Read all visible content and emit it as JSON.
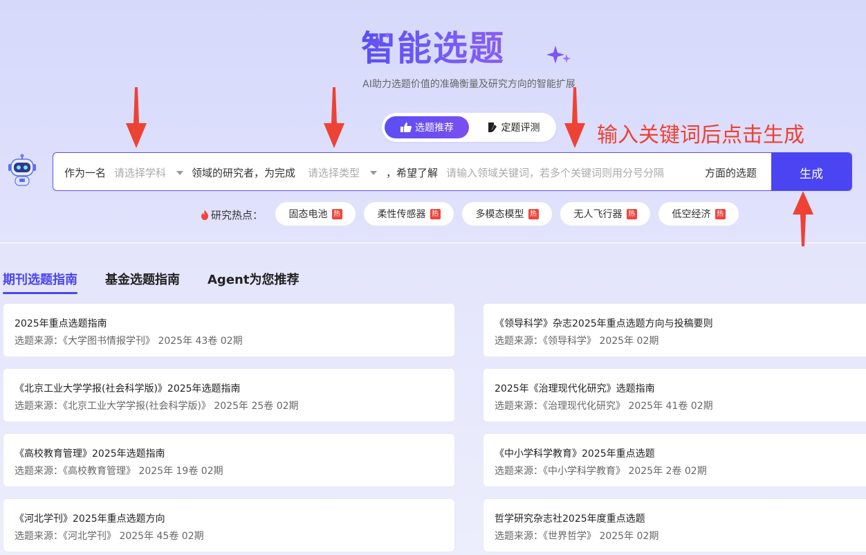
{
  "header": {
    "title": "智能选题",
    "subtitle": "AI助力选题价值的准确衡量及研究方向的智能扩展"
  },
  "mode_toggle": {
    "active_label": "选题推荐",
    "inactive_label": "定题评测"
  },
  "annotation": {
    "hint_text": "输入关键词后点击生成"
  },
  "query_builder": {
    "prefix": "作为一名",
    "subject_placeholder": "请选择学科",
    "middle": "领域的研究者，为完成",
    "type_placeholder": "请选择类型",
    "middle2": "，希望了解",
    "keyword_placeholder": "请输入领域关键词，若多个关键词则用分号分隔",
    "suffix": "方面的选题",
    "generate_label": "生成"
  },
  "hot_topics": {
    "label": "研究热点：",
    "badge": "热",
    "items": [
      "固态电池",
      "柔性传感器",
      "多模态模型",
      "无人飞行器",
      "低空经济"
    ]
  },
  "tabs": [
    "期刊选题指南",
    "基金选题指南",
    "Agent为您推荐"
  ],
  "guides": {
    "left": [
      {
        "title": "2025年重点选题指南",
        "meta": "选题来源：《大学图书情报学刊》  2025年 43卷 02期"
      },
      {
        "title": "《北京工业大学学报(社会科学版)》2025年选题指南",
        "meta": "选题来源：《北京工业大学学报(社会科学版)》  2025年 25卷 02期"
      },
      {
        "title": "《高校教育管理》2025年选题指南",
        "meta": "选题来源：《高校教育管理》  2025年 19卷 02期"
      },
      {
        "title": "《河北学刊》2025年重点选题方向",
        "meta": "选题来源：《河北学刊》  2025年 45卷 02期"
      }
    ],
    "right": [
      {
        "title": "《领导科学》杂志2025年重点选题方向与投稿要则",
        "meta": "选题来源：《领导科学》  2025年 02期"
      },
      {
        "title": "2025年《治理现代化研究》选题指南",
        "meta": "选题来源：《治理现代化研究》  2025年 41卷 02期"
      },
      {
        "title": "《中小学科学教育》2025年重点选题",
        "meta": "选题来源：《中小学科学教育》  2025年 2卷 02期"
      },
      {
        "title": "哲学研究杂志社2025年度重点选题",
        "meta": "选题来源：《世界哲学》  2025年 02期"
      }
    ]
  },
  "colors": {
    "accent": "#4a44f2",
    "hint": "#ef4030",
    "hot_badge": "#f0443a"
  }
}
